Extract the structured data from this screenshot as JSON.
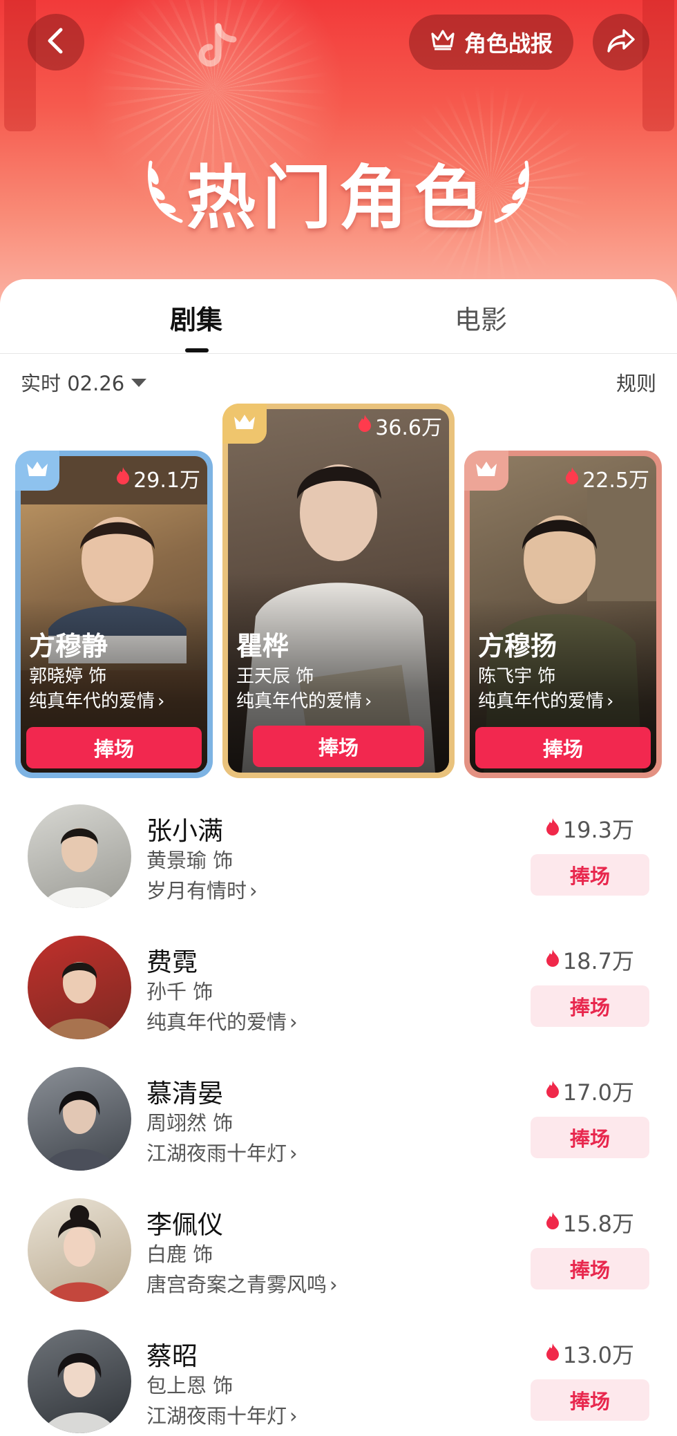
{
  "header": {
    "report_label": "角色战报",
    "title": "热门角色"
  },
  "tabs": [
    {
      "label": "剧集",
      "active": true
    },
    {
      "label": "电影",
      "active": false
    }
  ],
  "filter": {
    "label": "实时 02.26",
    "rules_label": "规则"
  },
  "top_cards": [
    {
      "rank": 2,
      "heat": "29.1万",
      "name": "方穆静",
      "actor": "郭晓婷 饰",
      "drama": "纯真年代的爱情",
      "cheer_label": "捧场",
      "frame_color": "#7db3e3",
      "crown_color": "#8ec2ee"
    },
    {
      "rank": 1,
      "heat": "36.6万",
      "name": "瞿桦",
      "actor": "王天辰 饰",
      "drama": "纯真年代的爱情",
      "cheer_label": "捧场",
      "frame_color": "#e9c27c",
      "crown_color": "#efc56d"
    },
    {
      "rank": 3,
      "heat": "22.5万",
      "name": "方穆扬",
      "actor": "陈飞宇 饰",
      "drama": "纯真年代的爱情",
      "cheer_label": "捧场",
      "frame_color": "#e39182",
      "crown_color": "#eda597"
    }
  ],
  "list": [
    {
      "name": "张小满",
      "actor": "黄景瑜 饰",
      "drama": "岁月有情时",
      "heat": "19.3万",
      "cheer_label": "捧场"
    },
    {
      "name": "费霓",
      "actor": "孙千 饰",
      "drama": "纯真年代的爱情",
      "heat": "18.7万",
      "cheer_label": "捧场"
    },
    {
      "name": "慕清晏",
      "actor": "周翊然 饰",
      "drama": "江湖夜雨十年灯",
      "heat": "17.0万",
      "cheer_label": "捧场"
    },
    {
      "name": "李佩仪",
      "actor": "白鹿 饰",
      "drama": "唐宫奇案之青雾风鸣",
      "heat": "15.8万",
      "cheer_label": "捧场"
    },
    {
      "name": "蔡昭",
      "actor": "包上恩 饰",
      "drama": "江湖夜雨十年灯",
      "heat": "13.0万",
      "cheer_label": "捧场"
    }
  ],
  "colors": {
    "accent": "#f2284f",
    "cheer_light_bg": "#fde8ec",
    "header_red": "#f23a3a"
  }
}
